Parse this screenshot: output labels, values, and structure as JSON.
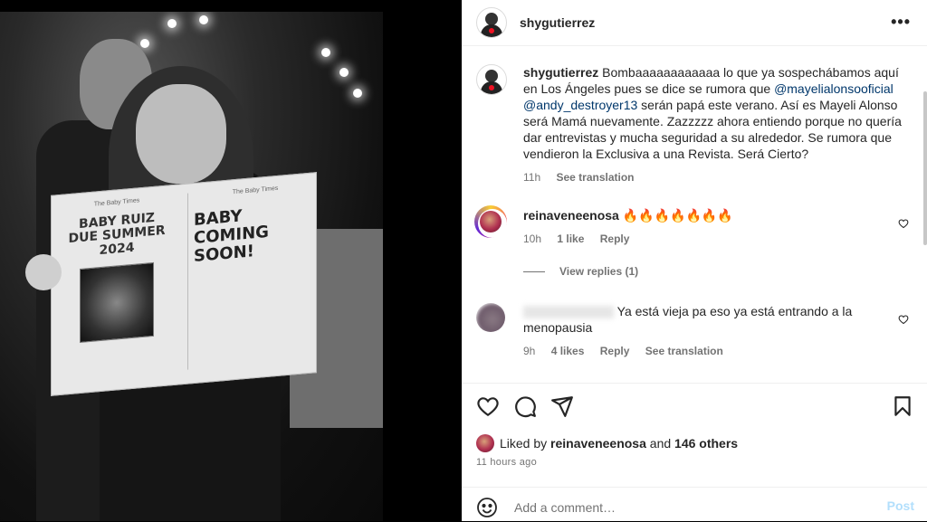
{
  "header": {
    "username": "shygutierrez"
  },
  "photo": {
    "left_headline": "BABY RUIZ\nDUE SUMMER 2024",
    "left_masthead": "The Baby Times",
    "right_masthead": "The Baby Times",
    "right_headline": "BABY\nCOMING SOON!"
  },
  "caption": {
    "username": "shygutierrez",
    "text_part1": " Bombaaaaaaaaaaaa lo que ya sospechábamos aquí en Los Ángeles pues se dice se rumora que ",
    "mention1": "@mayelialonsooficial",
    "text_part2": " ",
    "mention2": "@andy_destroyer13",
    "text_part3": " serán papá este verano. Así es Mayeli Alonso será Mamá nuevamente. Zazzzzz ahora entiendo porque no quería dar entrevistas y mucha seguridad a su alrededor. Se rumora que vendieron la Exclusiva a una Revista. Será Cierto?",
    "time": "11h",
    "see_translation": "See translation"
  },
  "comments": [
    {
      "username": "reinaveneenosa",
      "text": "🔥🔥🔥🔥🔥🔥🔥",
      "time": "10h",
      "likes": "1 like",
      "reply": "Reply",
      "view_replies": "View replies (1)"
    },
    {
      "username": "",
      "text": "Ya está vieja pa eso ya está entrando a la menopausia",
      "time": "9h",
      "likes": "4 likes",
      "reply": "Reply",
      "see_translation": "See translation"
    }
  ],
  "likes": {
    "prefix": "Liked by ",
    "user": "reinaveneenosa",
    "and": " and ",
    "others": "146 others"
  },
  "timestamp": "11 hours ago",
  "add_comment": {
    "placeholder": "Add a comment…",
    "post": "Post"
  }
}
